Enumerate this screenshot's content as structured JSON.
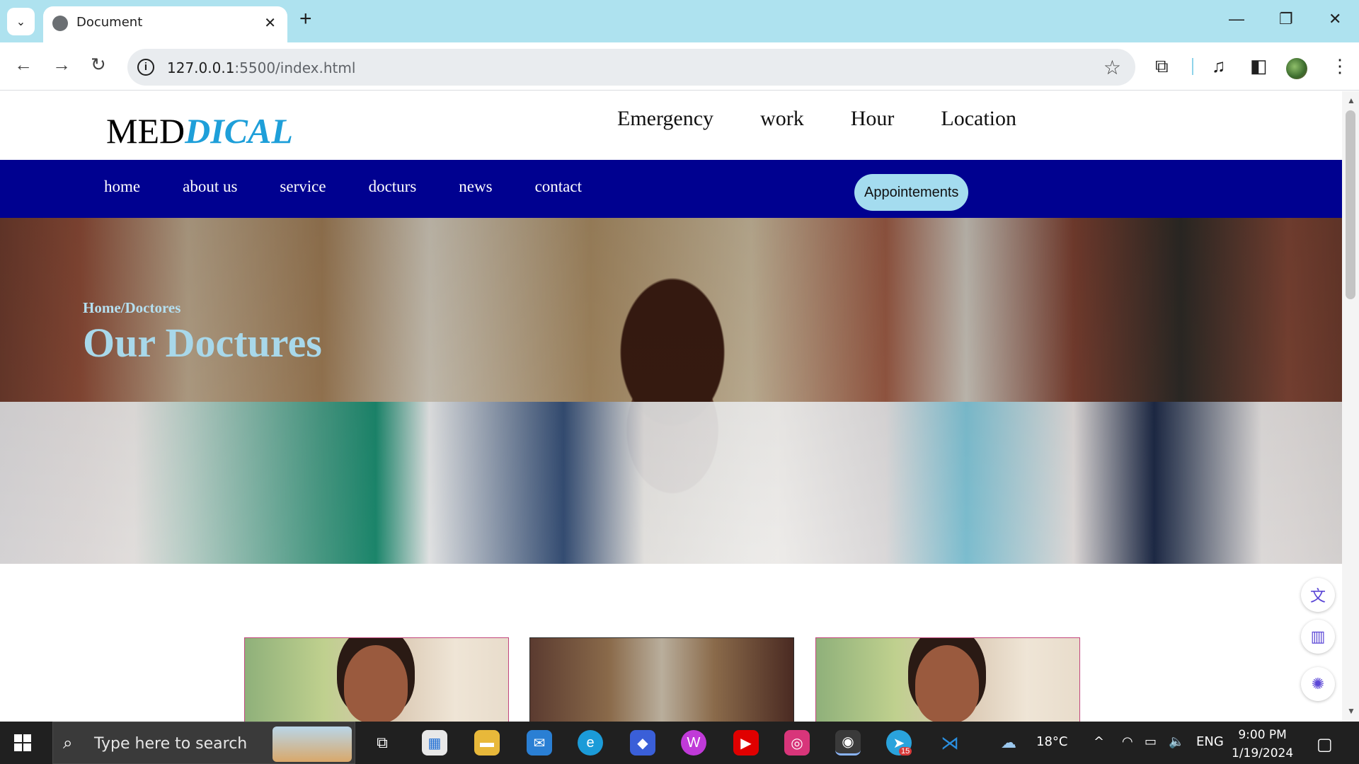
{
  "browser": {
    "tab_title": "Document",
    "url_host": "127.0.0.1",
    "url_rest": ":5500/index.html"
  },
  "site": {
    "logo_plain": "MED",
    "logo_accent": "DICAL",
    "top_links": [
      "Emergency",
      "work",
      "Hour",
      "Location"
    ],
    "nav_links": [
      "home",
      "about us",
      "service",
      "docturs",
      "news",
      "contact"
    ],
    "appointments_button": "Appointements",
    "breadcrumb": "Home/Doctores",
    "hero_title": "Our Doctures"
  },
  "taskbar": {
    "search_placeholder": "Type here to search",
    "weather": "18°C",
    "language": "ENG",
    "time": "9:00 PM",
    "date": "1/19/2024",
    "telegram_badge": "15"
  },
  "colors": {
    "accent_blue": "#1e9fd9",
    "nav_bg": "#000190",
    "button_bg": "#a4dcef",
    "tabbar_bg": "#aee2ef"
  }
}
